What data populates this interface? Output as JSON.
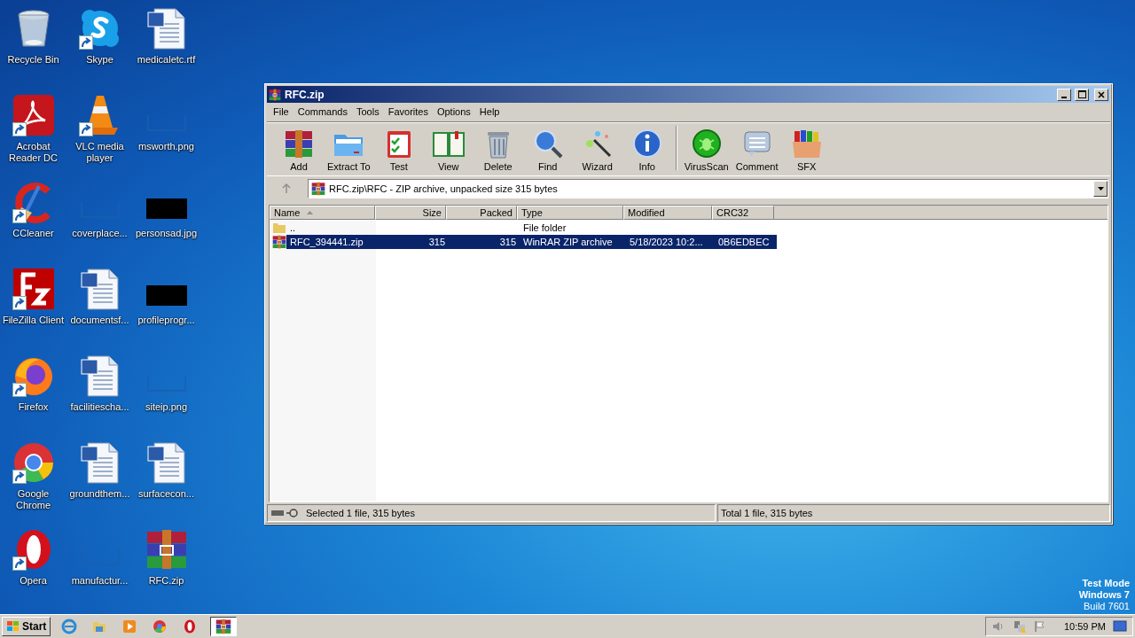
{
  "desktop": {
    "icons": [
      {
        "label": "Recycle Bin",
        "kind": "recycle",
        "shortcut": false
      },
      {
        "label": "Acrobat Reader DC",
        "kind": "acrobat",
        "shortcut": true
      },
      {
        "label": "CCleaner",
        "kind": "ccleaner",
        "shortcut": true
      },
      {
        "label": "FileZilla Client",
        "kind": "filezilla",
        "shortcut": true
      },
      {
        "label": "Firefox",
        "kind": "firefox",
        "shortcut": true
      },
      {
        "label": "Google Chrome",
        "kind": "chrome",
        "shortcut": true
      },
      {
        "label": "Opera",
        "kind": "opera",
        "shortcut": true
      },
      {
        "label": "Skype",
        "kind": "skype",
        "shortcut": true
      },
      {
        "label": "VLC media player",
        "kind": "vlc",
        "shortcut": true
      },
      {
        "label": "coverplace...",
        "kind": "blank",
        "shortcut": false
      },
      {
        "label": "documentsf...",
        "kind": "word",
        "shortcut": false
      },
      {
        "label": "facilitiescha...",
        "kind": "word",
        "shortcut": false
      },
      {
        "label": "groundthem...",
        "kind": "word",
        "shortcut": false
      },
      {
        "label": "manufactur...",
        "kind": "blank",
        "shortcut": false
      },
      {
        "label": "medicaletc.rtf",
        "kind": "word",
        "shortcut": false
      },
      {
        "label": "msworth.png",
        "kind": "blank",
        "shortcut": false
      },
      {
        "label": "personsad.jpg",
        "kind": "black",
        "shortcut": false
      },
      {
        "label": "profileprogr...",
        "kind": "black",
        "shortcut": false
      },
      {
        "label": "siteip.png",
        "kind": "blank",
        "shortcut": false
      },
      {
        "label": "surfacecon...",
        "kind": "word",
        "shortcut": false
      },
      {
        "label": "RFC.zip",
        "kind": "winrar",
        "shortcut": false
      }
    ]
  },
  "window": {
    "title": "RFC.zip",
    "menu": [
      "File",
      "Commands",
      "Tools",
      "Favorites",
      "Options",
      "Help"
    ],
    "toolbar": [
      {
        "label": "Add",
        "kind": "add"
      },
      {
        "label": "Extract To",
        "kind": "extract"
      },
      {
        "label": "Test",
        "kind": "test"
      },
      {
        "label": "View",
        "kind": "view"
      },
      {
        "label": "Delete",
        "kind": "delete"
      },
      {
        "label": "Find",
        "kind": "find"
      },
      {
        "label": "Wizard",
        "kind": "wizard"
      },
      {
        "label": "Info",
        "kind": "info"
      },
      {
        "label": "VirusScan",
        "kind": "virus"
      },
      {
        "label": "Comment",
        "kind": "comment"
      },
      {
        "label": "SFX",
        "kind": "sfx"
      }
    ],
    "address": "RFC.zip\\RFC - ZIP archive, unpacked size 315 bytes",
    "table": {
      "columns": [
        {
          "label": "Name",
          "sorted": true
        },
        {
          "label": "Size",
          "sorted": false
        },
        {
          "label": "Packed",
          "sorted": false
        },
        {
          "label": "Type",
          "sorted": false
        },
        {
          "label": "Modified",
          "sorted": false
        },
        {
          "label": "CRC32",
          "sorted": false
        }
      ],
      "rows": [
        {
          "kind": "folder",
          "selected": false,
          "name": "..",
          "type": "File folder"
        },
        {
          "kind": "archive",
          "selected": true,
          "name": "RFC_394441.zip",
          "size": "315",
          "packed": "315",
          "type": "WinRAR ZIP archive",
          "modified": "5/18/2023 10:2...",
          "crc32": "0B6EDBEC"
        }
      ]
    },
    "status_bar": {
      "left": "Selected 1 file, 315 bytes",
      "right": "Total 1 file, 315 bytes"
    }
  },
  "os_notice": [
    "Test Mode",
    "Windows 7",
    "Build 7601"
  ],
  "taskbar": {
    "start": "Start",
    "apps": [
      {
        "kind": "ie",
        "selected": false
      },
      {
        "kind": "explorer",
        "selected": false
      },
      {
        "kind": "media",
        "selected": false
      },
      {
        "kind": "chrome",
        "selected": false
      },
      {
        "kind": "opera",
        "selected": false
      },
      {
        "kind": "winrar",
        "selected": true
      }
    ],
    "clock": "10:59 PM"
  }
}
